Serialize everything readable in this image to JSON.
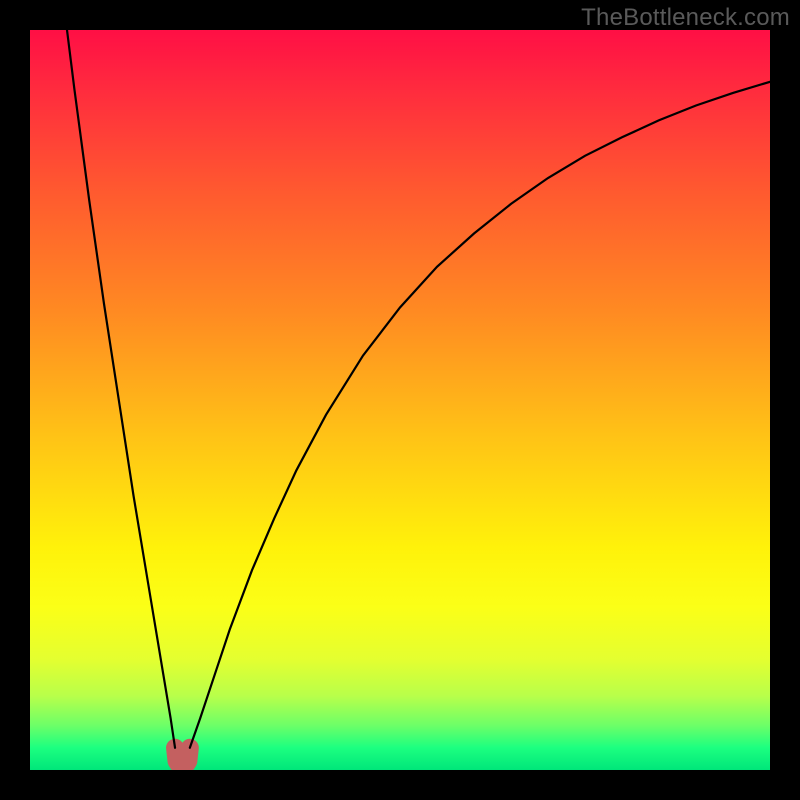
{
  "watermark": "TheBottleneck.com",
  "chart_data": {
    "type": "line",
    "title": "",
    "xlabel": "",
    "ylabel": "",
    "xlim": [
      0,
      100
    ],
    "ylim": [
      0,
      100
    ],
    "grid": false,
    "legend": false,
    "series": [
      {
        "name": "left-branch",
        "x": [
          5,
          6,
          7,
          8,
          9,
          10,
          11,
          12,
          13,
          14,
          15,
          16,
          17,
          18,
          19,
          19.6
        ],
        "values": [
          100,
          92,
          84.5,
          77,
          70,
          63,
          56.5,
          50,
          43.5,
          37,
          31,
          25,
          19,
          13,
          7,
          3
        ]
      },
      {
        "name": "right-branch",
        "x": [
          21.6,
          23,
          25,
          27,
          30,
          33,
          36,
          40,
          45,
          50,
          55,
          60,
          65,
          70,
          75,
          80,
          85,
          90,
          95,
          100
        ],
        "values": [
          3,
          7,
          13,
          19,
          27,
          34,
          40.5,
          48,
          56,
          62.5,
          68,
          72.5,
          76.5,
          80,
          83,
          85.5,
          87.8,
          89.8,
          91.5,
          93
        ]
      },
      {
        "name": "bottom-marker",
        "x": [
          19.6,
          19.8,
          20.2,
          20.6,
          21.0,
          21.4,
          21.6
        ],
        "values": [
          3,
          1.2,
          0.6,
          0.5,
          0.6,
          1.2,
          3
        ]
      }
    ],
    "colors": {
      "curve": "#000000",
      "marker": "#c46060"
    },
    "background_gradient": {
      "top": "#ff0f45",
      "mid": "#ffd800",
      "bottom": "#00e67a"
    }
  }
}
